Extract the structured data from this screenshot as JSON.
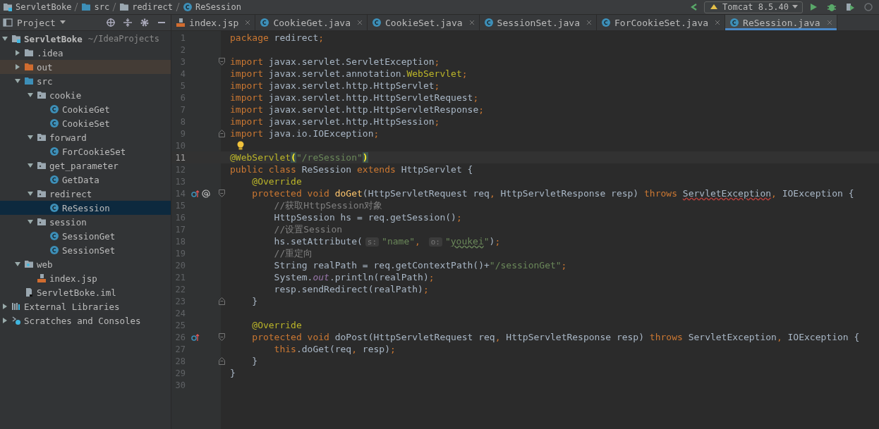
{
  "navigation_bar": {
    "breadcrumbs": [
      {
        "label": "ServletBoke",
        "kind": "module"
      },
      {
        "label": "src",
        "kind": "source-folder"
      },
      {
        "label": "redirect",
        "kind": "package"
      },
      {
        "label": "ReSession",
        "kind": "class"
      }
    ],
    "run_configuration": "Tomcat 8.5.40"
  },
  "project_panel": {
    "title": "Project",
    "tree": [
      {
        "label": "ServletBoke",
        "suffix": "~/IdeaProjects",
        "kind": "module",
        "expanded": true,
        "selected": false,
        "children": [
          {
            "label": ".idea",
            "kind": "folder",
            "expanded": false,
            "selected": false
          },
          {
            "label": "out",
            "kind": "excluded-folder",
            "expanded": false,
            "selected": false
          },
          {
            "label": "src",
            "kind": "source-folder",
            "expanded": true,
            "selected": false,
            "children": [
              {
                "label": "cookie",
                "kind": "package",
                "expanded": true,
                "selected": false,
                "children": [
                  {
                    "label": "CookieGet",
                    "kind": "class",
                    "selected": false
                  },
                  {
                    "label": "CookieSet",
                    "kind": "class",
                    "selected": false
                  }
                ]
              },
              {
                "label": "forward",
                "kind": "package",
                "expanded": true,
                "selected": false,
                "children": [
                  {
                    "label": "ForCookieSet",
                    "kind": "class",
                    "selected": false
                  }
                ]
              },
              {
                "label": "get_parameter",
                "kind": "package",
                "expanded": true,
                "selected": false,
                "children": [
                  {
                    "label": "GetData",
                    "kind": "class",
                    "selected": false
                  }
                ]
              },
              {
                "label": "redirect",
                "kind": "package",
                "expanded": true,
                "selected": false,
                "children": [
                  {
                    "label": "ReSession",
                    "kind": "class",
                    "selected": true
                  }
                ]
              },
              {
                "label": "session",
                "kind": "package",
                "expanded": true,
                "selected": false,
                "children": [
                  {
                    "label": "SessionGet",
                    "kind": "class",
                    "selected": false
                  },
                  {
                    "label": "SessionSet",
                    "kind": "class",
                    "selected": false
                  }
                ]
              }
            ]
          },
          {
            "label": "web",
            "kind": "web-folder",
            "expanded": true,
            "selected": false,
            "children": [
              {
                "label": "index.jsp",
                "kind": "jsp",
                "selected": false
              }
            ]
          },
          {
            "label": "ServletBoke.iml",
            "kind": "iml",
            "selected": false
          }
        ]
      },
      {
        "label": "External Libraries",
        "kind": "libraries",
        "expanded": false,
        "selected": false
      },
      {
        "label": "Scratches and Consoles",
        "kind": "scratches",
        "expanded": false,
        "selected": false
      }
    ]
  },
  "editor_tabs": [
    {
      "label": "index.jsp",
      "kind": "jsp",
      "selected": false
    },
    {
      "label": "CookieGet.java",
      "kind": "class",
      "selected": false
    },
    {
      "label": "CookieSet.java",
      "kind": "class",
      "selected": false
    },
    {
      "label": "SessionSet.java",
      "kind": "class",
      "selected": false
    },
    {
      "label": "ForCookieSet.java",
      "kind": "class",
      "selected": false
    },
    {
      "label": "ReSession.java",
      "kind": "class",
      "selected": true
    }
  ],
  "code_lines": [
    {
      "number": "1",
      "current": false,
      "tokens": [
        {
          "kind": "kw",
          "text": "package"
        },
        {
          "kind": "plain",
          "text": " redirect"
        },
        {
          "kind": "kw",
          "text": ";"
        }
      ]
    },
    {
      "number": "2",
      "current": false
    },
    {
      "number": "3",
      "current": false,
      "markers": [
        {
          "kind": "fold-start"
        }
      ],
      "tokens": [
        {
          "kind": "kw",
          "text": "import"
        },
        {
          "kind": "plain",
          "text": " javax.servlet.ServletException"
        },
        {
          "kind": "kw",
          "text": ";"
        }
      ]
    },
    {
      "number": "4",
      "current": false,
      "tokens": [
        {
          "kind": "kw",
          "text": "import"
        },
        {
          "kind": "plain",
          "text": " javax.servlet.annotation."
        },
        {
          "kind": "ann",
          "text": "WebServlet"
        },
        {
          "kind": "kw",
          "text": ";"
        }
      ]
    },
    {
      "number": "5",
      "current": false,
      "tokens": [
        {
          "kind": "kw",
          "text": "import"
        },
        {
          "kind": "plain",
          "text": " javax.servlet.http.HttpServlet"
        },
        {
          "kind": "kw",
          "text": ";"
        }
      ]
    },
    {
      "number": "6",
      "current": false,
      "tokens": [
        {
          "kind": "kw",
          "text": "import"
        },
        {
          "kind": "plain",
          "text": " javax.servlet.http.HttpServletRequest"
        },
        {
          "kind": "kw",
          "text": ";"
        }
      ]
    },
    {
      "number": "7",
      "current": false,
      "tokens": [
        {
          "kind": "kw",
          "text": "import"
        },
        {
          "kind": "plain",
          "text": " javax.servlet.http.HttpServletResponse"
        },
        {
          "kind": "kw",
          "text": ";"
        }
      ]
    },
    {
      "number": "8",
      "current": false,
      "tokens": [
        {
          "kind": "kw",
          "text": "import"
        },
        {
          "kind": "plain",
          "text": " javax.servlet.http.HttpSession"
        },
        {
          "kind": "kw",
          "text": ";"
        }
      ]
    },
    {
      "number": "9",
      "current": false,
      "markers": [
        {
          "kind": "fold-end"
        }
      ],
      "tokens": [
        {
          "kind": "kw",
          "text": "import"
        },
        {
          "kind": "plain",
          "text": " java.io.IOException"
        },
        {
          "kind": "kw",
          "text": ";"
        }
      ]
    },
    {
      "number": "10",
      "current": false,
      "markers": [
        {
          "kind": "bulb"
        }
      ]
    },
    {
      "number": "11",
      "current": true,
      "tokens": [
        {
          "kind": "ann",
          "text": "@WebServlet"
        },
        {
          "kind": "brace",
          "text": "("
        },
        {
          "kind": "str",
          "text": "\"/reSession\""
        },
        {
          "kind": "brace",
          "text": ")"
        }
      ]
    },
    {
      "number": "12",
      "current": false,
      "tokens": [
        {
          "kind": "kw",
          "text": "public class "
        },
        {
          "kind": "plain",
          "text": "ReSession "
        },
        {
          "kind": "kw",
          "text": "extends "
        },
        {
          "kind": "plain",
          "text": "HttpServlet {"
        }
      ]
    },
    {
      "number": "13",
      "current": false,
      "tokens": [
        {
          "kind": "ann",
          "text": "    @Override"
        }
      ]
    },
    {
      "number": "14",
      "current": false,
      "markers": [
        {
          "kind": "override"
        },
        {
          "kind": "servlet"
        },
        {
          "kind": "fold-start"
        }
      ],
      "tokens": [
        {
          "kind": "kw",
          "text": "    protected void "
        },
        {
          "kind": "method",
          "text": "doGet"
        },
        {
          "kind": "plain",
          "text": "(HttpServletRequest req"
        },
        {
          "kind": "kw",
          "text": ", "
        },
        {
          "kind": "plain",
          "text": "HttpServletResponse resp) "
        },
        {
          "kind": "kw",
          "text": "throws "
        },
        {
          "kind": "warn",
          "text": "ServletException"
        },
        {
          "kind": "kw",
          "text": ", "
        },
        {
          "kind": "plain",
          "text": "IOException {"
        }
      ]
    },
    {
      "number": "15",
      "current": false,
      "tokens": [
        {
          "kind": "cmt",
          "text": "        //获取HttpSession对象"
        }
      ]
    },
    {
      "number": "16",
      "current": false,
      "tokens": [
        {
          "kind": "plain",
          "text": "        HttpSession hs = req.getSession()"
        },
        {
          "kind": "kw",
          "text": ";"
        }
      ]
    },
    {
      "number": "17",
      "current": false,
      "tokens": [
        {
          "kind": "cmt",
          "text": "        //设置Session"
        }
      ]
    },
    {
      "number": "18",
      "current": false,
      "tokens": [
        {
          "kind": "plain",
          "text": "        hs.setAttribute("
        },
        {
          "kind": "hint",
          "text": "s:"
        },
        {
          "kind": "str",
          "text": "\"name\""
        },
        {
          "kind": "kw",
          "text": ", "
        },
        {
          "kind": "hint",
          "text": "o:"
        },
        {
          "kind": "str",
          "text": "\""
        },
        {
          "kind": "typo",
          "text": "youkei"
        },
        {
          "kind": "str",
          "text": "\""
        },
        {
          "kind": "plain",
          "text": ")"
        },
        {
          "kind": "kw",
          "text": ";"
        }
      ]
    },
    {
      "number": "19",
      "current": false,
      "tokens": [
        {
          "kind": "cmt",
          "text": "        //重定向"
        }
      ]
    },
    {
      "number": "20",
      "current": false,
      "tokens": [
        {
          "kind": "plain",
          "text": "        String realPath = req.getContextPath()+"
        },
        {
          "kind": "str",
          "text": "\"/sessionGet\""
        },
        {
          "kind": "kw",
          "text": ";"
        }
      ]
    },
    {
      "number": "21",
      "current": false,
      "tokens": [
        {
          "kind": "plain",
          "text": "        System."
        },
        {
          "kind": "field",
          "text": "out"
        },
        {
          "kind": "plain",
          "text": ".println(realPath)"
        },
        {
          "kind": "kw",
          "text": ";"
        }
      ]
    },
    {
      "number": "22",
      "current": false,
      "tokens": [
        {
          "kind": "plain",
          "text": "        resp.sendRedirect(realPath)"
        },
        {
          "kind": "kw",
          "text": ";"
        }
      ]
    },
    {
      "number": "23",
      "current": false,
      "markers": [
        {
          "kind": "fold-end"
        }
      ],
      "tokens": [
        {
          "kind": "plain",
          "text": "    }"
        }
      ]
    },
    {
      "number": "24",
      "current": false
    },
    {
      "number": "25",
      "current": false,
      "tokens": [
        {
          "kind": "ann",
          "text": "    @Override"
        }
      ]
    },
    {
      "number": "26",
      "current": false,
      "markers": [
        {
          "kind": "override"
        },
        {
          "kind": "fold-start"
        }
      ],
      "tokens": [
        {
          "kind": "kw",
          "text": "    protected void "
        },
        {
          "kind": "plain",
          "text": "doPost(HttpServletRequest req"
        },
        {
          "kind": "kw",
          "text": ", "
        },
        {
          "kind": "plain",
          "text": "HttpServletResponse resp) "
        },
        {
          "kind": "kw",
          "text": "throws "
        },
        {
          "kind": "plain",
          "text": "ServletException"
        },
        {
          "kind": "kw",
          "text": ", "
        },
        {
          "kind": "plain",
          "text": "IOException {"
        }
      ]
    },
    {
      "number": "27",
      "current": false,
      "tokens": [
        {
          "kind": "kw",
          "text": "        this"
        },
        {
          "kind": "plain",
          "text": ".doGet(req"
        },
        {
          "kind": "kw",
          "text": ", "
        },
        {
          "kind": "plain",
          "text": "resp)"
        },
        {
          "kind": "kw",
          "text": ";"
        }
      ]
    },
    {
      "number": "28",
      "current": false,
      "markers": [
        {
          "kind": "fold-end"
        }
      ],
      "tokens": [
        {
          "kind": "plain",
          "text": "    }"
        }
      ]
    },
    {
      "number": "29",
      "current": false,
      "tokens": [
        {
          "kind": "plain",
          "text": "}"
        }
      ]
    },
    {
      "number": "30",
      "current": false
    }
  ]
}
